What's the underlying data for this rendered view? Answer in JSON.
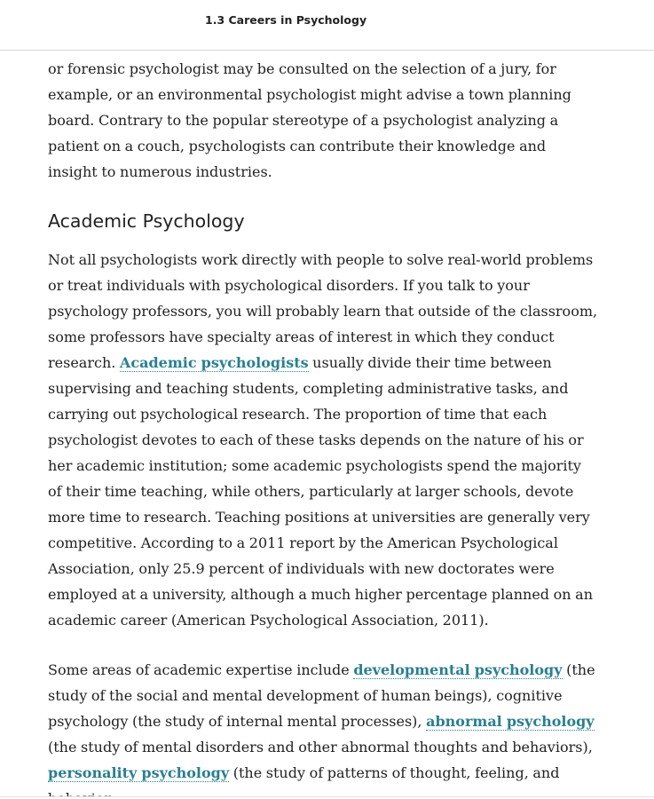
{
  "header": {
    "title": "1.3 Careers in Psychology"
  },
  "intro": {
    "text": "or forensic psychologist may be consulted on the selection of a jury, for example, or an environmental psychologist might advise a town planning board. Contrary to the popular stereotype of a psychologist analyzing a patient on a couch, psychologists can contribute their knowledge and insight to numerous industries."
  },
  "section": {
    "heading": "Academic Psychology",
    "p1_before": "Not all psychologists work directly with people to solve real-world problems or treat individuals with psychological disorders. If you talk to your psychology professors, you will probably learn that outside of the classroom, some professors have specialty areas of interest in which they conduct research. ",
    "p1_term": "Academic psychologists",
    "p1_after": " usually divide their time between supervising and teaching students, completing administrative tasks, and carrying out psychological research. The proportion of time that each psychologist devotes to each of these tasks depends on the nature of his or her academic institution; some academic psychologists spend the majority of their time teaching, while others, particularly at larger schools, devote more time to research. Teaching positions at universities are generally very competitive. According to a 2011 report by the American Psychological Association, only 25.9 percent of individuals with new doctorates were employed at a university, although a much higher percentage planned on an academic career (American Psychological Association, 2011).",
    "p2_a": "Some areas of academic expertise include ",
    "p2_term1": "developmental psychology",
    "p2_b": " (the study of the social and mental development of human beings), cognitive psychology (the study of internal mental processes), ",
    "p2_term2": "abnormal psychology",
    "p2_c": " (the study of mental disorders and other abnormal thoughts and behaviors), ",
    "p2_term3": "personality psychology",
    "p2_d": " (the study of patterns of thought, feeling, and behavior"
  }
}
